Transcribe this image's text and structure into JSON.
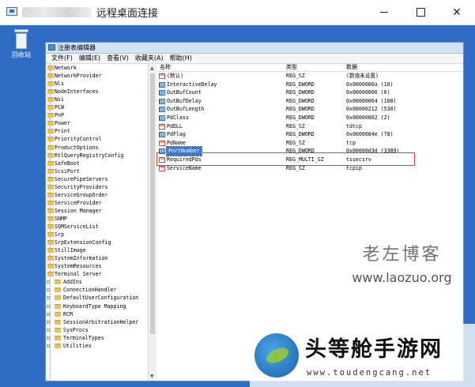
{
  "window": {
    "title": "远程桌面连接",
    "controls": {
      "minimize": "minimize-icon",
      "maximize": "maximize-icon",
      "close": "✕"
    }
  },
  "desktop": {
    "recycle_bin_label": "回收站"
  },
  "regedit": {
    "title": "注册表编辑器",
    "menu": [
      "文件(F)",
      "编辑(E)",
      "查看(V)",
      "收藏夹(A)",
      "帮助(H)"
    ],
    "tree_items": [
      "Network",
      "NetworkProvider",
      "Nls",
      "NodeInterfaces",
      "Nsi",
      "PCW",
      "PnP",
      "Power",
      "Print",
      "PriorityControl",
      "ProductOptions",
      "RtlQueryRegistryConfig",
      "SafeBoot",
      "ScsiPort",
      "SecurePipeServers",
      "SecurityProviders",
      "ServiceGroupOrder",
      "ServiceProvider",
      "Session Manager",
      "SNMP",
      "SQMServiceList",
      "Srp",
      "SrpExtensionConfig",
      "StillImage",
      "SystemInformation",
      "SystemResources",
      "Terminal Server"
    ],
    "tree_subitems": [
      "AddIns",
      "ConnectionHandler",
      "DefaultUserConfiguration",
      "KeyboardType Mapping",
      "RCM",
      "SessionArbitrationHelper",
      "SysProcs",
      "TerminalTypes",
      "Utilities"
    ],
    "columns": {
      "name": "名称",
      "type": "类型",
      "data": "数据"
    },
    "values": [
      {
        "name": "(默认)",
        "type": "REG_SZ",
        "data": "(数值未设置)",
        "kind": "sz"
      },
      {
        "name": "InteractiveDelay",
        "type": "REG_DWORD",
        "data": "0x0000000a (10)",
        "kind": "dw"
      },
      {
        "name": "OutBufCount",
        "type": "REG_DWORD",
        "data": "0x00000006 (6)",
        "kind": "dw"
      },
      {
        "name": "OutBufDelay",
        "type": "REG_DWORD",
        "data": "0x00000064 (100)",
        "kind": "dw"
      },
      {
        "name": "OutBufLength",
        "type": "REG_DWORD",
        "data": "0x00000212 (530)",
        "kind": "dw"
      },
      {
        "name": "PdClass",
        "type": "REG_DWORD",
        "data": "0x00000002 (2)",
        "kind": "dw"
      },
      {
        "name": "PdDLL",
        "type": "REG_SZ",
        "data": "tdtcp",
        "kind": "sz"
      },
      {
        "name": "PdFlag",
        "type": "REG_DWORD",
        "data": "0x0000004e (78)",
        "kind": "dw"
      },
      {
        "name": "PdName",
        "type": "REG_SZ",
        "data": "tcp",
        "kind": "sz"
      },
      {
        "name": "PortNumber",
        "type": "REG_DWORD",
        "data": "0x00000d3d (3389)",
        "kind": "dw",
        "selected": true
      },
      {
        "name": "RequiredPds",
        "type": "REG_MULTI_SZ",
        "data": "tssecsrv",
        "kind": "sz"
      },
      {
        "name": "ServiceName",
        "type": "REG_SZ",
        "data": "tcpip",
        "kind": "sz"
      }
    ]
  },
  "watermarks": {
    "site1_name": "老左博客",
    "site1_url": "www.laozuo.org",
    "site2_name": "头等舱手游网",
    "site2_url": "www.toudengcang.net"
  },
  "colors": {
    "desktop": "#2f6cc6",
    "selection": "#3a77d0",
    "highlight_border": "#d6482b"
  }
}
